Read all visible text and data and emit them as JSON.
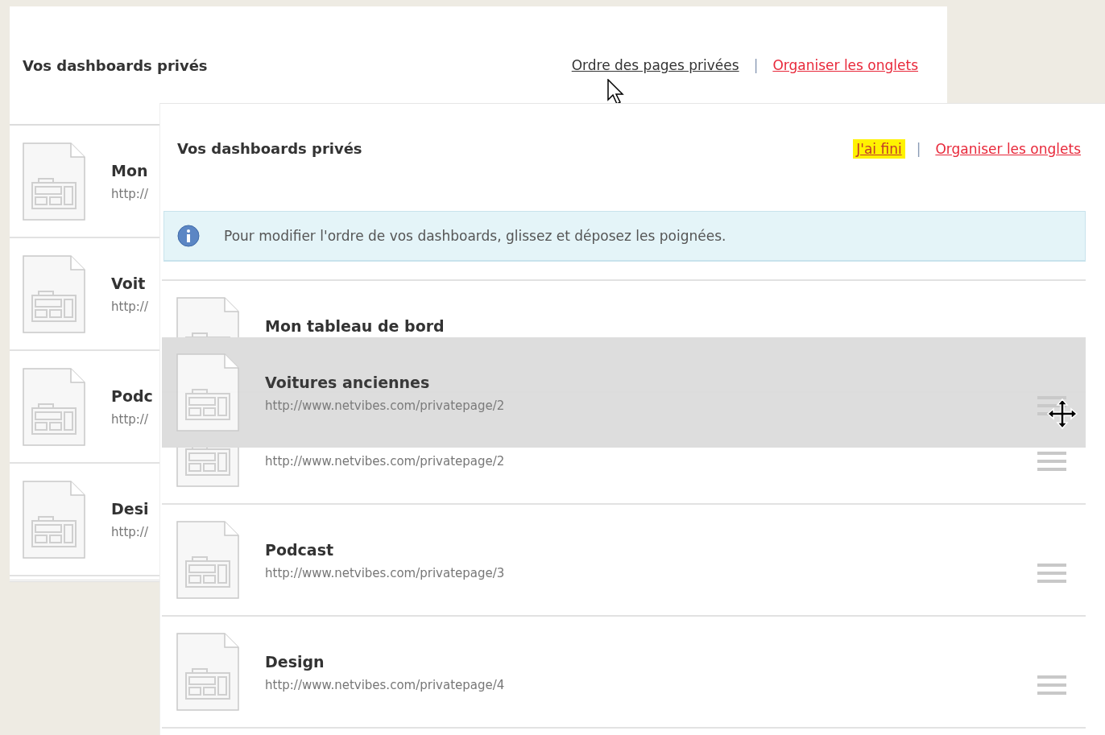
{
  "back_panel": {
    "title": "Vos dashboards privés",
    "separator": "|",
    "links": [
      {
        "label": "Ordre des pages privées",
        "kind": "plain"
      },
      {
        "label": "Organiser les onglets",
        "kind": "accent"
      }
    ],
    "rows": [
      {
        "title": "Mon",
        "url": "http://"
      },
      {
        "title": "Voit",
        "url": "http://"
      },
      {
        "title": "Podc",
        "url": "http://"
      },
      {
        "title": "Desi",
        "url": "http://"
      }
    ]
  },
  "front_panel": {
    "title": "Vos dashboards privés",
    "separator": "|",
    "links": [
      {
        "label": "J'ai fini",
        "kind": "highlight"
      },
      {
        "label": "Organiser les onglets",
        "kind": "accent"
      }
    ],
    "info": "Pour modifier l'ordre de vos dashboards, glissez et déposez les poignées.",
    "rows": [
      {
        "title": "Mon tableau de bord",
        "handle": false
      },
      {
        "url": "http://www.netvibes.com/privatepage/2",
        "handle": true
      },
      {
        "title": "Podcast",
        "url": "http://www.netvibes.com/privatepage/3",
        "handle": true
      },
      {
        "title": "Design",
        "url": "http://www.netvibes.com/privatepage/4",
        "handle": true
      }
    ],
    "dragged_row": {
      "title": "Voitures anciennes",
      "url": "http://www.netvibes.com/privatepage/2",
      "handle": true
    }
  }
}
